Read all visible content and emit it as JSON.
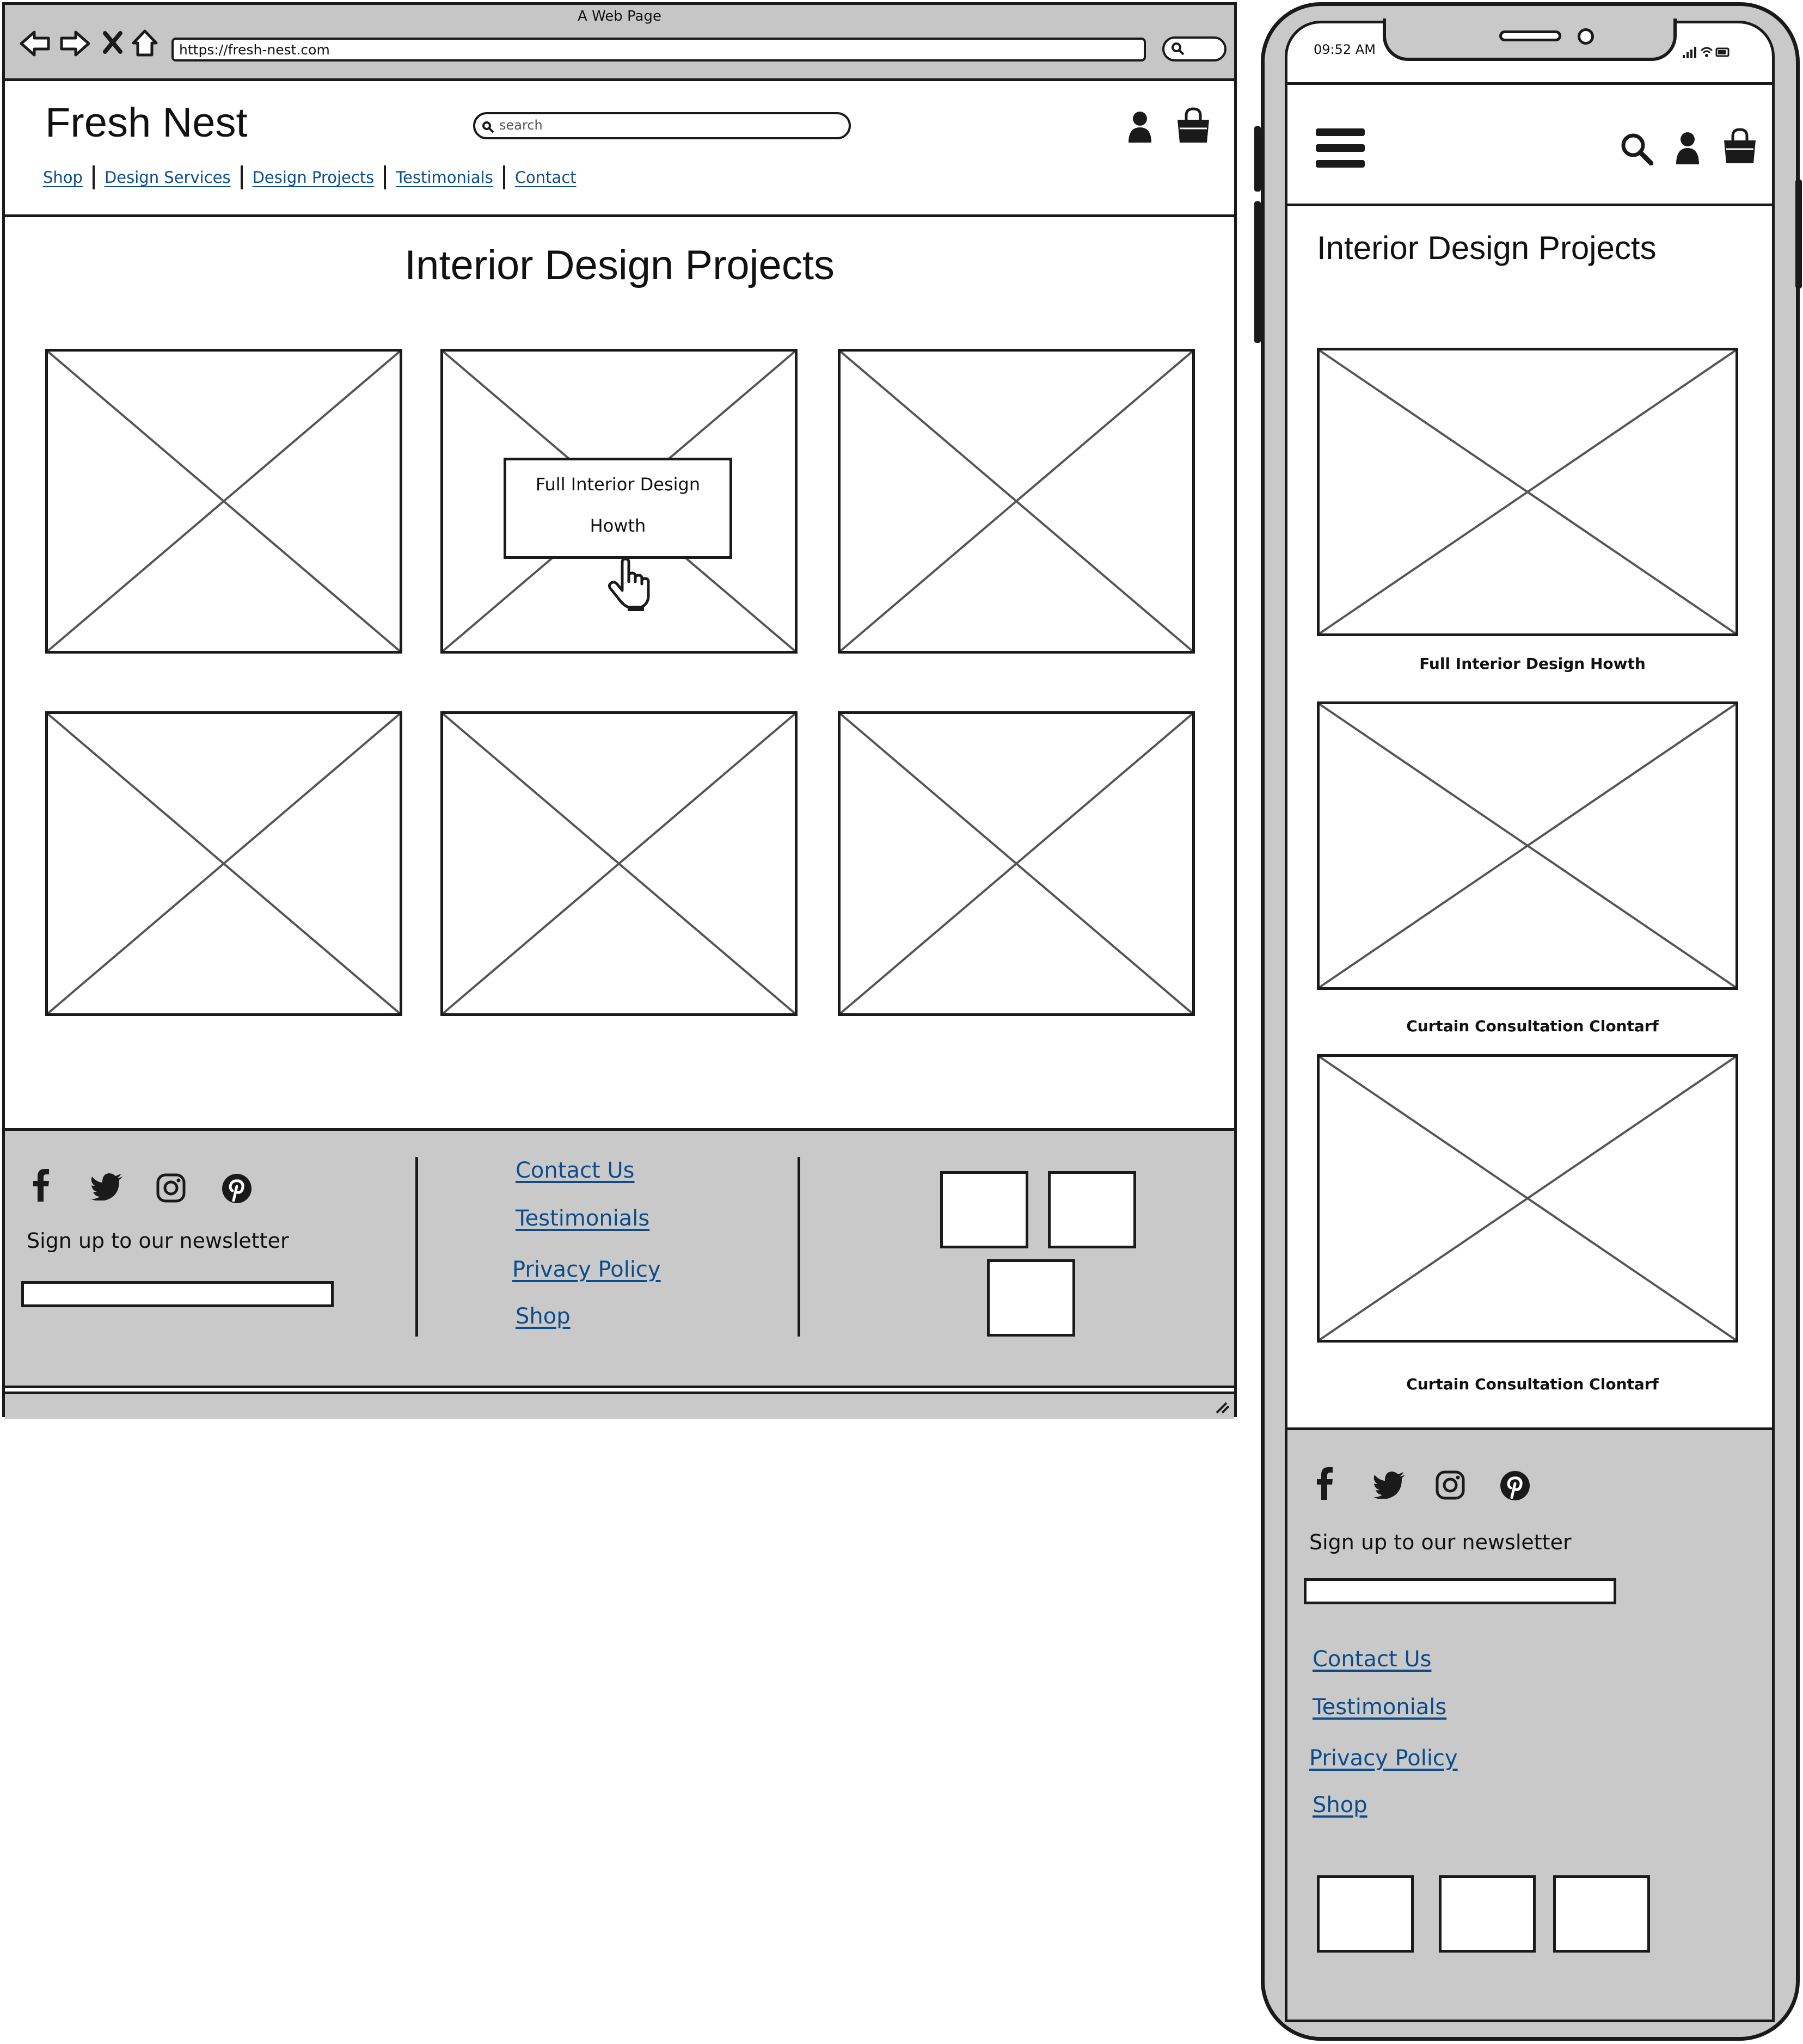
{
  "desktop": {
    "window_title": "A Web Page",
    "url": "https://fresh-nest.com",
    "brand": "Fresh Nest",
    "search_placeholder": "search",
    "nav": [
      "Shop",
      "Design Services",
      "Design Projects",
      "Testimonials",
      "Contact"
    ],
    "page_title": "Interior Design Projects",
    "hover_card": {
      "line1": "Full Interior Design",
      "line2": "Howth"
    },
    "footer": {
      "newsletter_label": "Sign up to our newsletter",
      "links": [
        "Contact Us",
        "Testimonials",
        "Privacy Policy",
        "Shop"
      ]
    }
  },
  "mobile": {
    "status_time": "09:52 AM",
    "page_title": "Interior Design Projects",
    "captions": [
      "Full Interior Design Howth",
      "Curtain Consultation Clontarf",
      "Curtain Consultation Clontarf"
    ],
    "footer": {
      "newsletter_label": "Sign up to our newsletter",
      "links": [
        "Contact Us",
        "Testimonials",
        "Privacy Policy",
        "Shop"
      ]
    }
  },
  "icons": {
    "social": [
      "facebook-icon",
      "twitter-icon",
      "instagram-icon",
      "pinterest-icon"
    ],
    "header": [
      "user-icon",
      "shopping-bag-icon",
      "search-icon",
      "hamburger-menu-icon"
    ]
  },
  "colors": {
    "link": "#0b4c8c",
    "chrome_gray": "#c9c9c9",
    "stroke": "#1a1a1a"
  }
}
